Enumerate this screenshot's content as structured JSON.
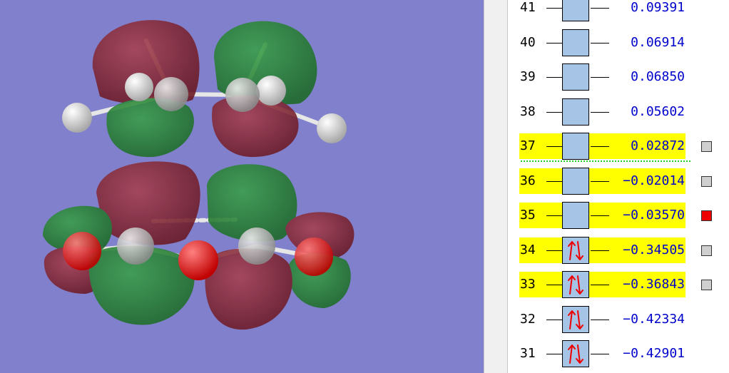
{
  "viewport": {
    "background_color": "#8080cc",
    "lobe_colors": {
      "negative": "#7a1f2b",
      "positive": "#227a2c"
    },
    "atom_colors": {
      "carbon": "#c8c8c8",
      "hydrogen": "#ffffff",
      "oxygen": "#ff0000"
    }
  },
  "orbital_levels": [
    {
      "number": "41",
      "energy": "0.09391",
      "occupied": false,
      "highlighted": false,
      "checkbox": null
    },
    {
      "number": "40",
      "energy": "0.06914",
      "occupied": false,
      "highlighted": false,
      "checkbox": null
    },
    {
      "number": "39",
      "energy": "0.06850",
      "occupied": false,
      "highlighted": false,
      "checkbox": null
    },
    {
      "number": "38",
      "energy": "0.05602",
      "occupied": false,
      "highlighted": false,
      "checkbox": null
    },
    {
      "number": "37",
      "energy": "0.02872",
      "occupied": false,
      "highlighted": true,
      "checkbox": "gray"
    },
    {
      "number": "36",
      "energy": "−0.02014",
      "occupied": false,
      "highlighted": true,
      "checkbox": "gray"
    },
    {
      "number": "35",
      "energy": "−0.03570",
      "occupied": false,
      "highlighted": true,
      "checkbox": "red"
    },
    {
      "number": "34",
      "energy": "−0.34505",
      "occupied": true,
      "highlighted": true,
      "checkbox": "gray"
    },
    {
      "number": "33",
      "energy": "−0.36843",
      "occupied": true,
      "highlighted": true,
      "checkbox": "gray"
    },
    {
      "number": "32",
      "energy": "−0.42334",
      "occupied": true,
      "highlighted": false,
      "checkbox": null
    },
    {
      "number": "31",
      "energy": "−0.42901",
      "occupied": true,
      "highlighted": false,
      "checkbox": null
    }
  ],
  "colors": {
    "highlight": "#ffff00",
    "level_box": "#a6c4e6",
    "energy_text": "#0000cc",
    "electron_arrow": "#ee0000",
    "homo_lumo_divider": "#22cc22",
    "checkbox_selected": "#ee0000",
    "checkbox_default": "#cfcfcf"
  },
  "icons": {
    "electron_pair": "spin-up-down-arrows-icon"
  }
}
